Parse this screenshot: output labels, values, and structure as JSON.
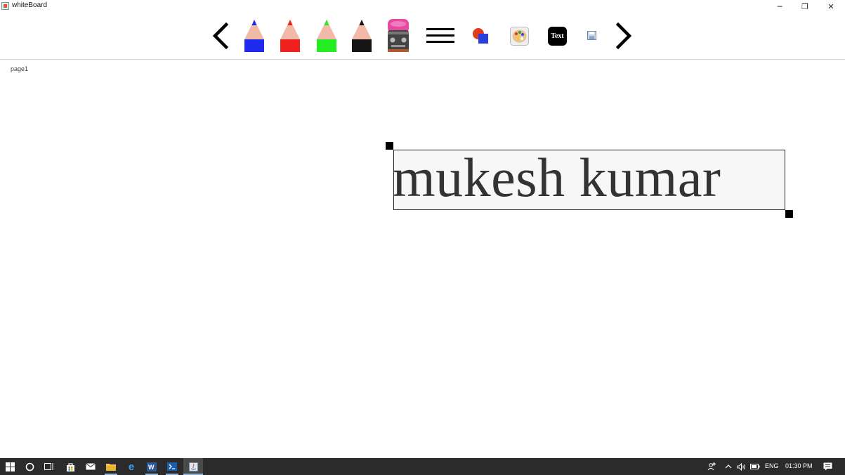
{
  "window": {
    "title": "whiteBoard",
    "minimize_glyph": "─",
    "maximize_glyph": "❐",
    "close_glyph": "✕"
  },
  "toolbar": {
    "tools": [
      {
        "name": "previous-page",
        "icon": "chevron-left-icon"
      },
      {
        "name": "blue-pencil",
        "color": "#1f2cf0"
      },
      {
        "name": "red-pencil",
        "color": "#f02020"
      },
      {
        "name": "green-pencil",
        "color": "#22ee22"
      },
      {
        "name": "black-pencil",
        "color": "#151515"
      },
      {
        "name": "eraser",
        "icon": "eraser-icon"
      },
      {
        "name": "line-width",
        "icon": "menu-lines-icon"
      },
      {
        "name": "shapes",
        "icon": "shapes-icon"
      },
      {
        "name": "color-palette",
        "icon": "palette-icon"
      },
      {
        "name": "text-tool",
        "label": "Text"
      },
      {
        "name": "save",
        "icon": "floppy-disk-icon"
      },
      {
        "name": "next-page",
        "icon": "chevron-right-icon"
      }
    ]
  },
  "canvas": {
    "page_label": "page1",
    "text_box_content": "mukesh kumar"
  },
  "taskbar": {
    "language": "ENG",
    "time": "01:30 PM"
  },
  "colors": {
    "taskbar_bg": "#2b2b2b",
    "pencil_tip": "#f0b9a8"
  }
}
